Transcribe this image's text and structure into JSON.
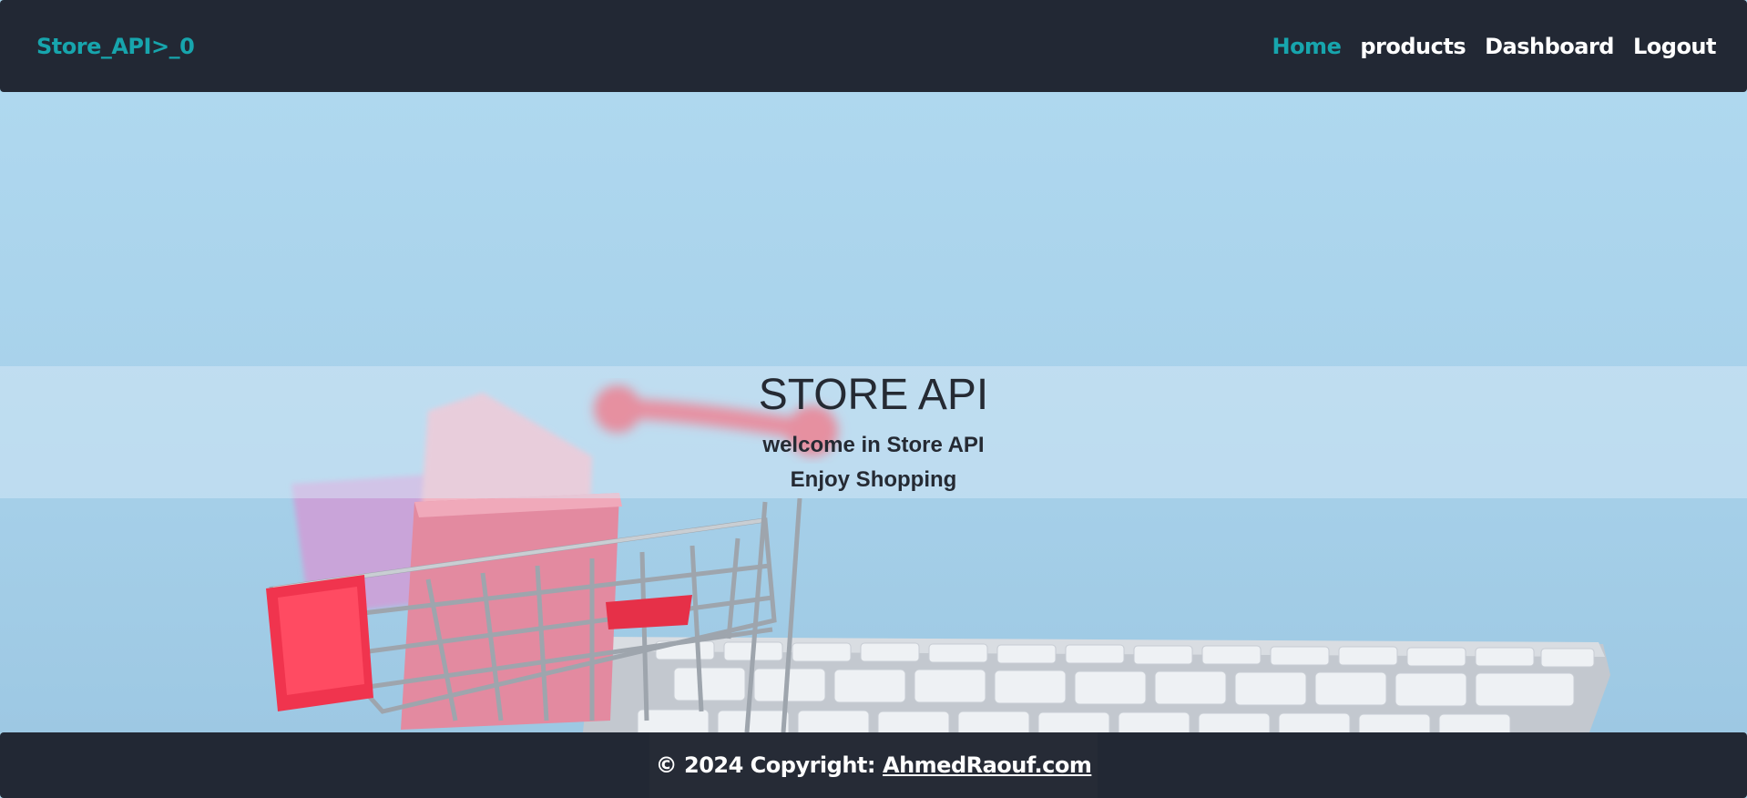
{
  "navbar": {
    "brand": "Store_API>_0",
    "links": [
      "Home",
      "products",
      "Dashboard",
      "Logout"
    ]
  },
  "hero": {
    "title": "STORE API",
    "subtitle1": "welcome in Store API",
    "subtitle2": "Enjoy Shopping"
  },
  "footer": {
    "copyright": "© 2024 Copyright:",
    "link": "AhmedRaouf.com"
  },
  "colors": {
    "navbar_bg": "#222834",
    "accent": "#17a5ad",
    "hero_bg": "#a9d4ea"
  }
}
